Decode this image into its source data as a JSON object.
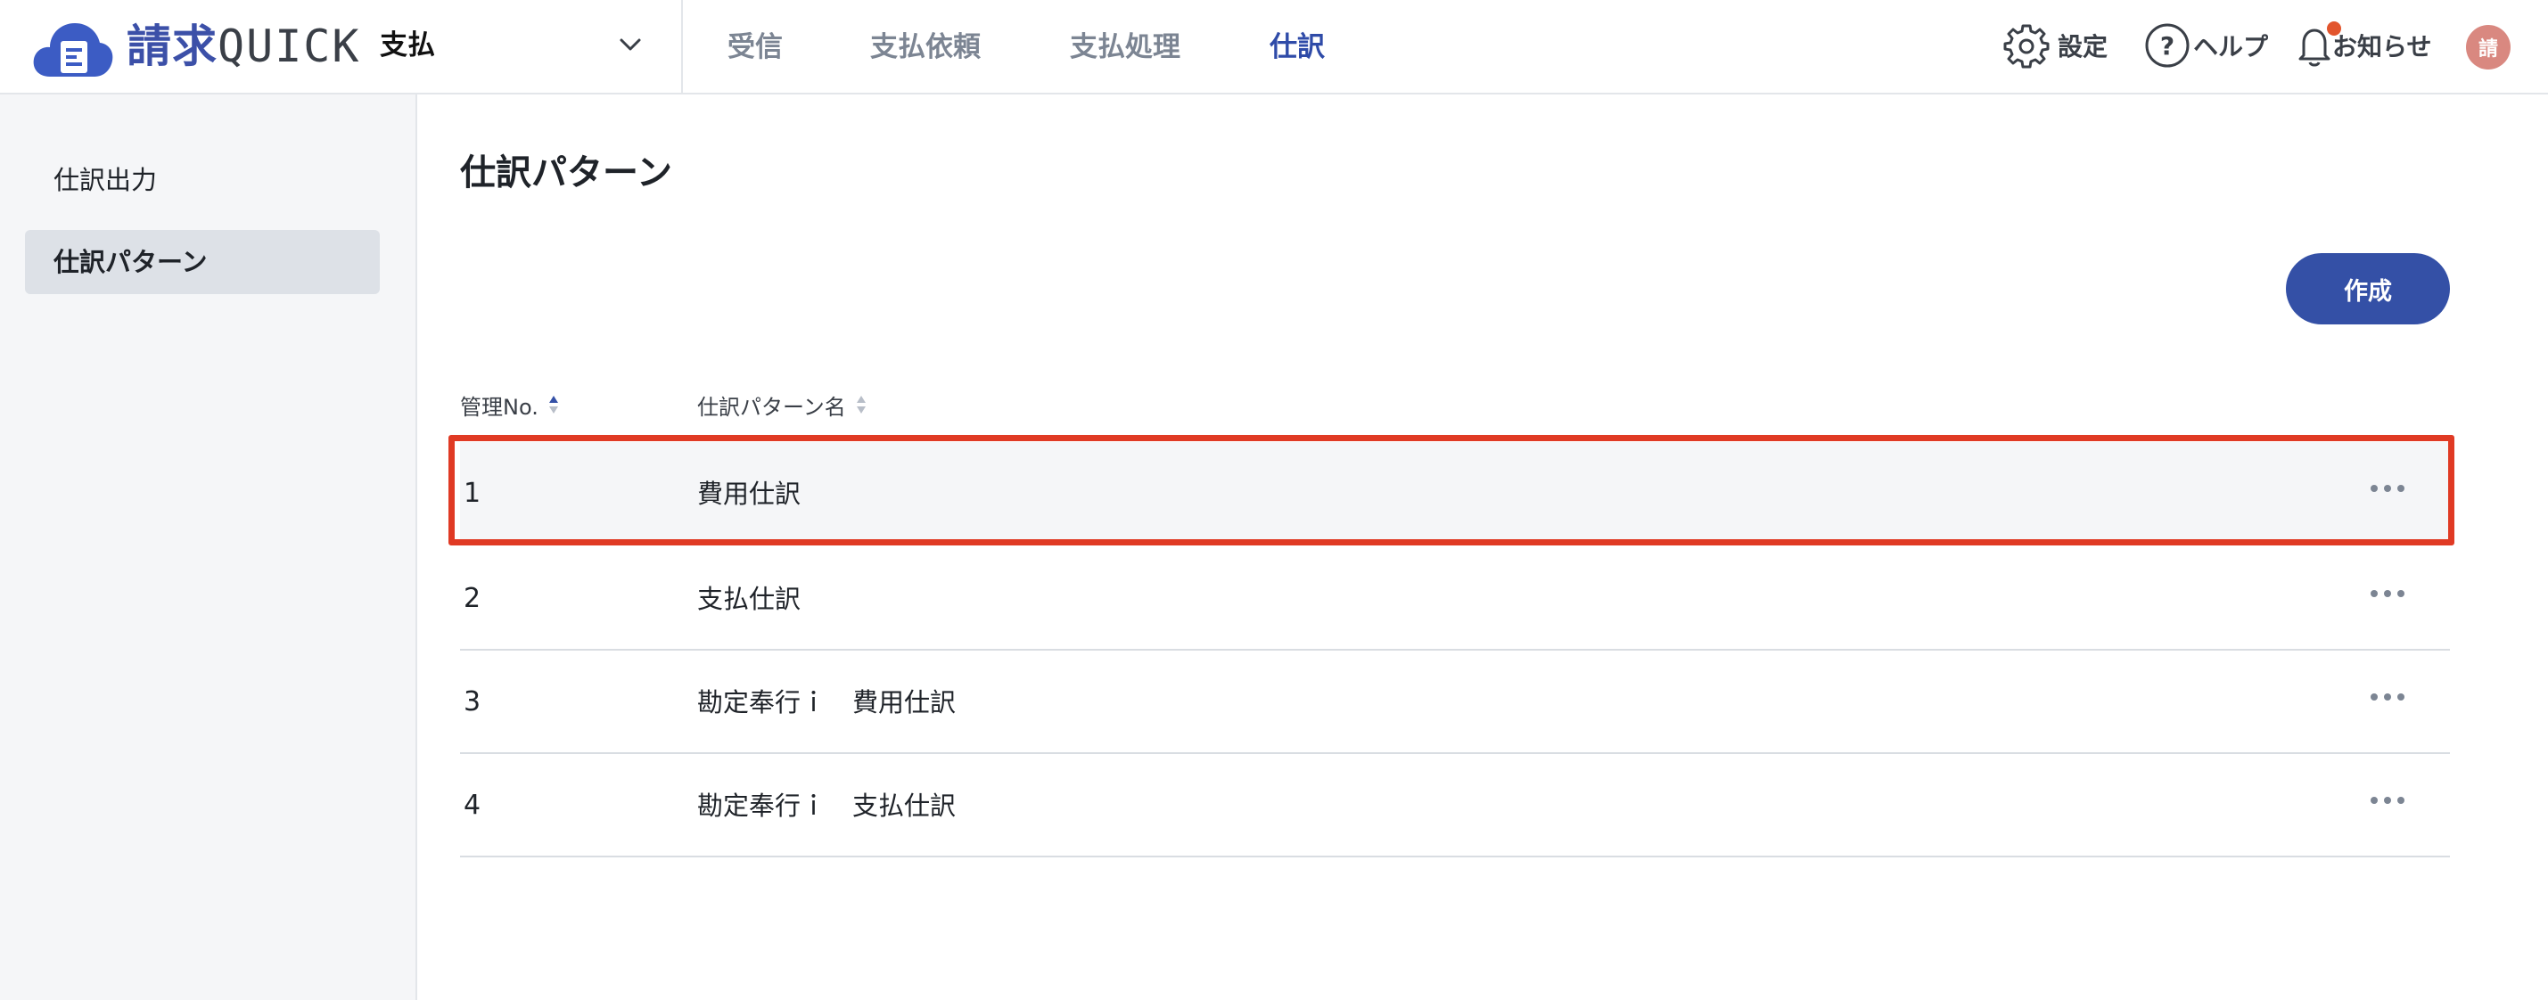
{
  "header": {
    "logo_kanji": "請求",
    "logo_latin": "QUICK",
    "module": "支払",
    "nav": [
      "受信",
      "支払依頼",
      "支払処理",
      "仕訳"
    ],
    "active_nav": "仕訳",
    "settings_label": "設定",
    "help_label": "ヘルプ",
    "notice_label": "お知らせ",
    "avatar_initial": "請"
  },
  "sidebar": {
    "items": [
      {
        "label": "仕訳出力",
        "active": false
      },
      {
        "label": "仕訳パターン",
        "active": true
      }
    ]
  },
  "main": {
    "title": "仕訳パターン",
    "create_label": "作成",
    "columns": {
      "no": "管理No.",
      "name": "仕訳パターン名"
    },
    "rows": [
      {
        "no": "1",
        "name": "費用仕訳",
        "highlighted": true
      },
      {
        "no": "2",
        "name": "支払仕訳",
        "highlighted": false
      },
      {
        "no": "3",
        "name": "勘定奉行ｉ　費用仕訳",
        "highlighted": false
      },
      {
        "no": "4",
        "name": "勘定奉行ｉ　支払仕訳",
        "highlighted": false
      }
    ]
  },
  "colors": {
    "brand": "#3c50a8",
    "primary_button": "#3450a6",
    "active_nav": "#2f4ba8",
    "highlight_border": "#e03a24",
    "notice_dot": "#e2552d",
    "avatar": "#d98880"
  }
}
